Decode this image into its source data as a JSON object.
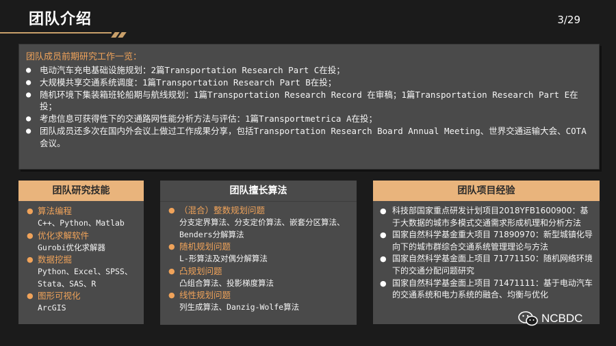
{
  "header": {
    "title": "团队介绍",
    "page": "3/29"
  },
  "intro": {
    "heading": "团队成员前期研究工作一览：",
    "items": [
      "电动汽车充电基础设施规划：2篇Transportation Research Part C在投；",
      "大规模共享交通系统调度：1篇Transportation Research Part B在投；",
      "随机环境下集装箱班轮船期与航线规划：1篇Transportation Research Record 在审稿；1篇Transportation Research Part E在投；",
      "考虑信息可获得性下的交通路网性能分析方法与评估：1篇Transportmetrica A在投；",
      "团队成员还多次在国内外会议上做过工作成果分享，包括Transportation Research Board Annual Meeting、世界交通运输大会、COTA会议。"
    ]
  },
  "skills": {
    "title": "团队研究技能",
    "groups": [
      {
        "category": "算法编程",
        "detail": "C++、Python、Matlab"
      },
      {
        "category": "优化求解软件",
        "detail": "Gurobi优化求解器"
      },
      {
        "category": "数据挖掘",
        "detail": "Python、Excel、SPSS、Stata、SAS、R"
      },
      {
        "category": "图形可视化",
        "detail": "ArcGIS"
      }
    ]
  },
  "algorithms": {
    "title": "团队擅长算法",
    "groups": [
      {
        "category": "（混合）整数规划问题",
        "detail": "分支定界算法、分支定价算法、嵌套分区算法、Benders分解算法"
      },
      {
        "category": "随机规划问题",
        "detail": "L-形算法及对偶分解算法"
      },
      {
        "category": "凸规划问题",
        "detail": "凸组合算法、投影梯度算法"
      },
      {
        "category": "线性规划问题",
        "detail": "列生成算法、Danzig-Wolfe算法"
      }
    ]
  },
  "projects": {
    "title": "团队项目经验",
    "items": [
      "科技部国家重点研发计划项目2018YFB1600900：基于大数据的城市多模式交通需求形成机理和分析方法",
      "国家自然科学基金重大项目 71890970：新型城镇化导向下的城市群综合交通系统管理理论与方法",
      "国家自然科学基金面上项目 71771150：随机网络环境下的交通分配问题研究",
      "国家自然科学基金面上项目 71471111：基于电动汽车的交通系统和电力系统的融合、均衡与优化"
    ]
  },
  "watermark": {
    "text": "NCBDC",
    "icon": "wechat-icon"
  },
  "colors": {
    "accent": "#e9b47c",
    "highlight_text": "#f0a35a",
    "panel": "#4a4a4a",
    "background": "#1b1b1b"
  }
}
